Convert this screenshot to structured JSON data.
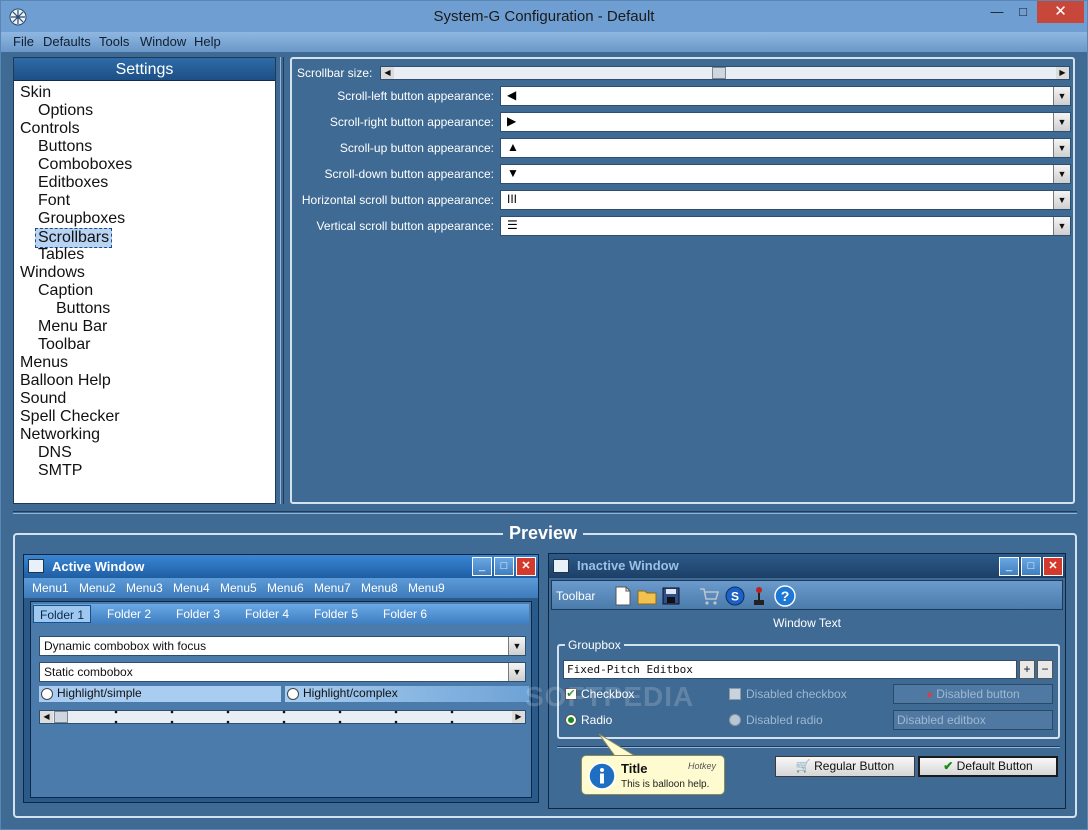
{
  "window": {
    "title": "System-G Configuration - Default"
  },
  "menubar": [
    "File",
    "Defaults",
    "Tools",
    "Window",
    "Help"
  ],
  "settings": {
    "header": "Settings",
    "tree": [
      {
        "label": "Skin",
        "level": 0
      },
      {
        "label": "Options",
        "level": 1
      },
      {
        "label": "Controls",
        "level": 0
      },
      {
        "label": "Buttons",
        "level": 1
      },
      {
        "label": "Comboboxes",
        "level": 1
      },
      {
        "label": "Editboxes",
        "level": 1
      },
      {
        "label": "Font",
        "level": 1
      },
      {
        "label": "Groupboxes",
        "level": 1
      },
      {
        "label": "Scrollbars",
        "level": 1,
        "selected": true
      },
      {
        "label": "Tables",
        "level": 1
      },
      {
        "label": "Windows",
        "level": 0
      },
      {
        "label": "Caption",
        "level": 1
      },
      {
        "label": "Buttons",
        "level": 2
      },
      {
        "label": "Menu Bar",
        "level": 1
      },
      {
        "label": "Toolbar",
        "level": 1
      },
      {
        "label": "Menus",
        "level": 0
      },
      {
        "label": "Balloon Help",
        "level": 0
      },
      {
        "label": "Sound",
        "level": 0
      },
      {
        "label": "Spell Checker",
        "level": 0
      },
      {
        "label": "Networking",
        "level": 0
      },
      {
        "label": "DNS",
        "level": 1
      },
      {
        "label": "SMTP",
        "level": 1
      }
    ]
  },
  "options": {
    "scrollbar_size_label": "Scrollbar size:",
    "scrollbar_size_level": 0.49,
    "rows": [
      {
        "label": "Scroll-left button appearance:",
        "glyph": "◀"
      },
      {
        "label": "Scroll-right button appearance:",
        "glyph": "▶"
      },
      {
        "label": "Scroll-up button appearance:",
        "glyph": "▲"
      },
      {
        "label": "Scroll-down button appearance:",
        "glyph": "▼"
      },
      {
        "label": "Horizontal scroll button appearance:",
        "glyph": "III"
      },
      {
        "label": "Vertical scroll button appearance:",
        "glyph": "☰"
      }
    ]
  },
  "preview": {
    "title": "Preview",
    "active": {
      "caption": "Active Window",
      "menus": [
        "Menu1",
        "Menu2",
        "Menu3",
        "Menu4",
        "Menu5",
        "Menu6",
        "Menu7",
        "Menu8",
        "Menu9"
      ],
      "tabs": [
        "Folder 1",
        "Folder 2",
        "Folder 3",
        "Folder 4",
        "Folder 5",
        "Folder 6"
      ],
      "combo_focus": "Dynamic combobox with focus",
      "combo_static": "Static combobox",
      "radio_simple": "Highlight/simple",
      "radio_complex": "Highlight/complex"
    },
    "inactive": {
      "caption": "Inactive Window",
      "toolbar_label": "Toolbar",
      "window_text": "Window Text",
      "groupbox_title": "Groupbox",
      "editbox": "Fixed-Pitch Editbox",
      "spin_plus": "+",
      "spin_minus": "−",
      "checkbox": "Checkbox",
      "disabled_checkbox": "Disabled checkbox",
      "disabled_button": "Disabled button",
      "radio": "Radio",
      "disabled_radio": "Disabled radio",
      "disabled_editbox": "Disabled editbox",
      "regular_button": "Regular Button",
      "default_button": "Default Button"
    },
    "balloon": {
      "title": "Title",
      "hotkey": "Hotkey",
      "text": "This is balloon help."
    },
    "watermark": "SOFTPEDIA"
  }
}
